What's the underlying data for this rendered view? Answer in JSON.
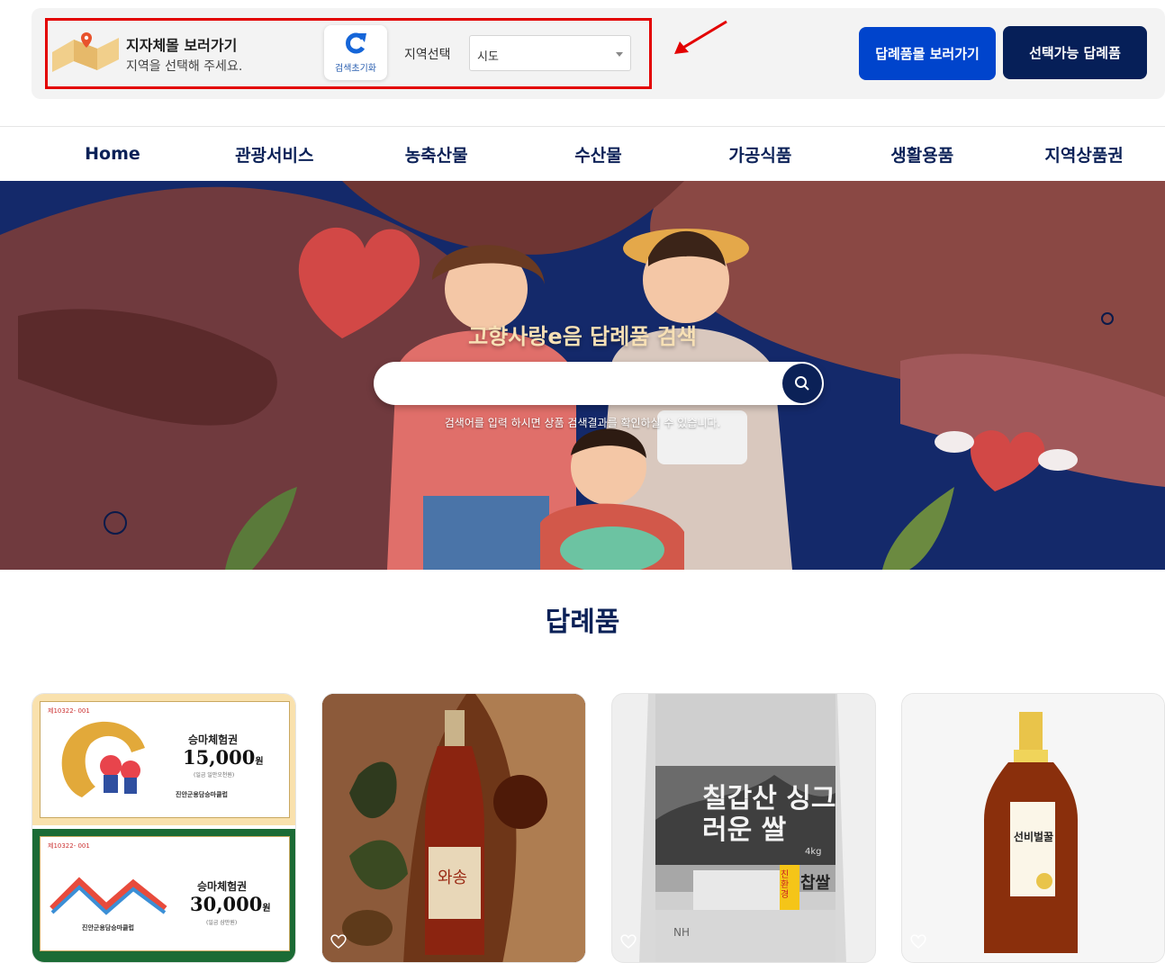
{
  "topbar": {
    "jijache_title": "지자체몰 보러가기",
    "jijache_sub": "지역을 선택해 주세요.",
    "reset_label": "검색초기화",
    "region_label": "지역선택",
    "region_selected": "시도",
    "btn_products": "답례품몰 보러가기",
    "btn_selectable": "선택가능 답례품"
  },
  "nav": [
    "Home",
    "관광서비스",
    "농축산물",
    "수산물",
    "가공식품",
    "생활용품",
    "지역상품권"
  ],
  "hero": {
    "title": "고향사랑e음 답례품 검색",
    "hint": "검색어를 입력 하시면 상품 검색결과를 확인하실 수 있습니다."
  },
  "section": {
    "title": "답례품"
  },
  "cards": [
    {
      "vouchers": [
        {
          "num": "제10322- 001",
          "name": "승마체험권",
          "price": "15,000",
          "unit": "원",
          "small": "(일금 일만오천원)",
          "club": "진안군용담승마클럽"
        },
        {
          "num": "제10322- 001",
          "name": "승마체험권",
          "price": "30,000",
          "unit": "원",
          "small": "(일금 삼만원)",
          "club": "진안군용담승마클럽"
        }
      ]
    },
    {
      "label": "와송"
    },
    {
      "label_big": "칠갑산 싱그러운 쌀",
      "label_bag": "찹쌀",
      "weight": "4kg",
      "tag": "친환경",
      "bottom": "NH"
    },
    {
      "label": "선비벌꿀"
    }
  ]
}
